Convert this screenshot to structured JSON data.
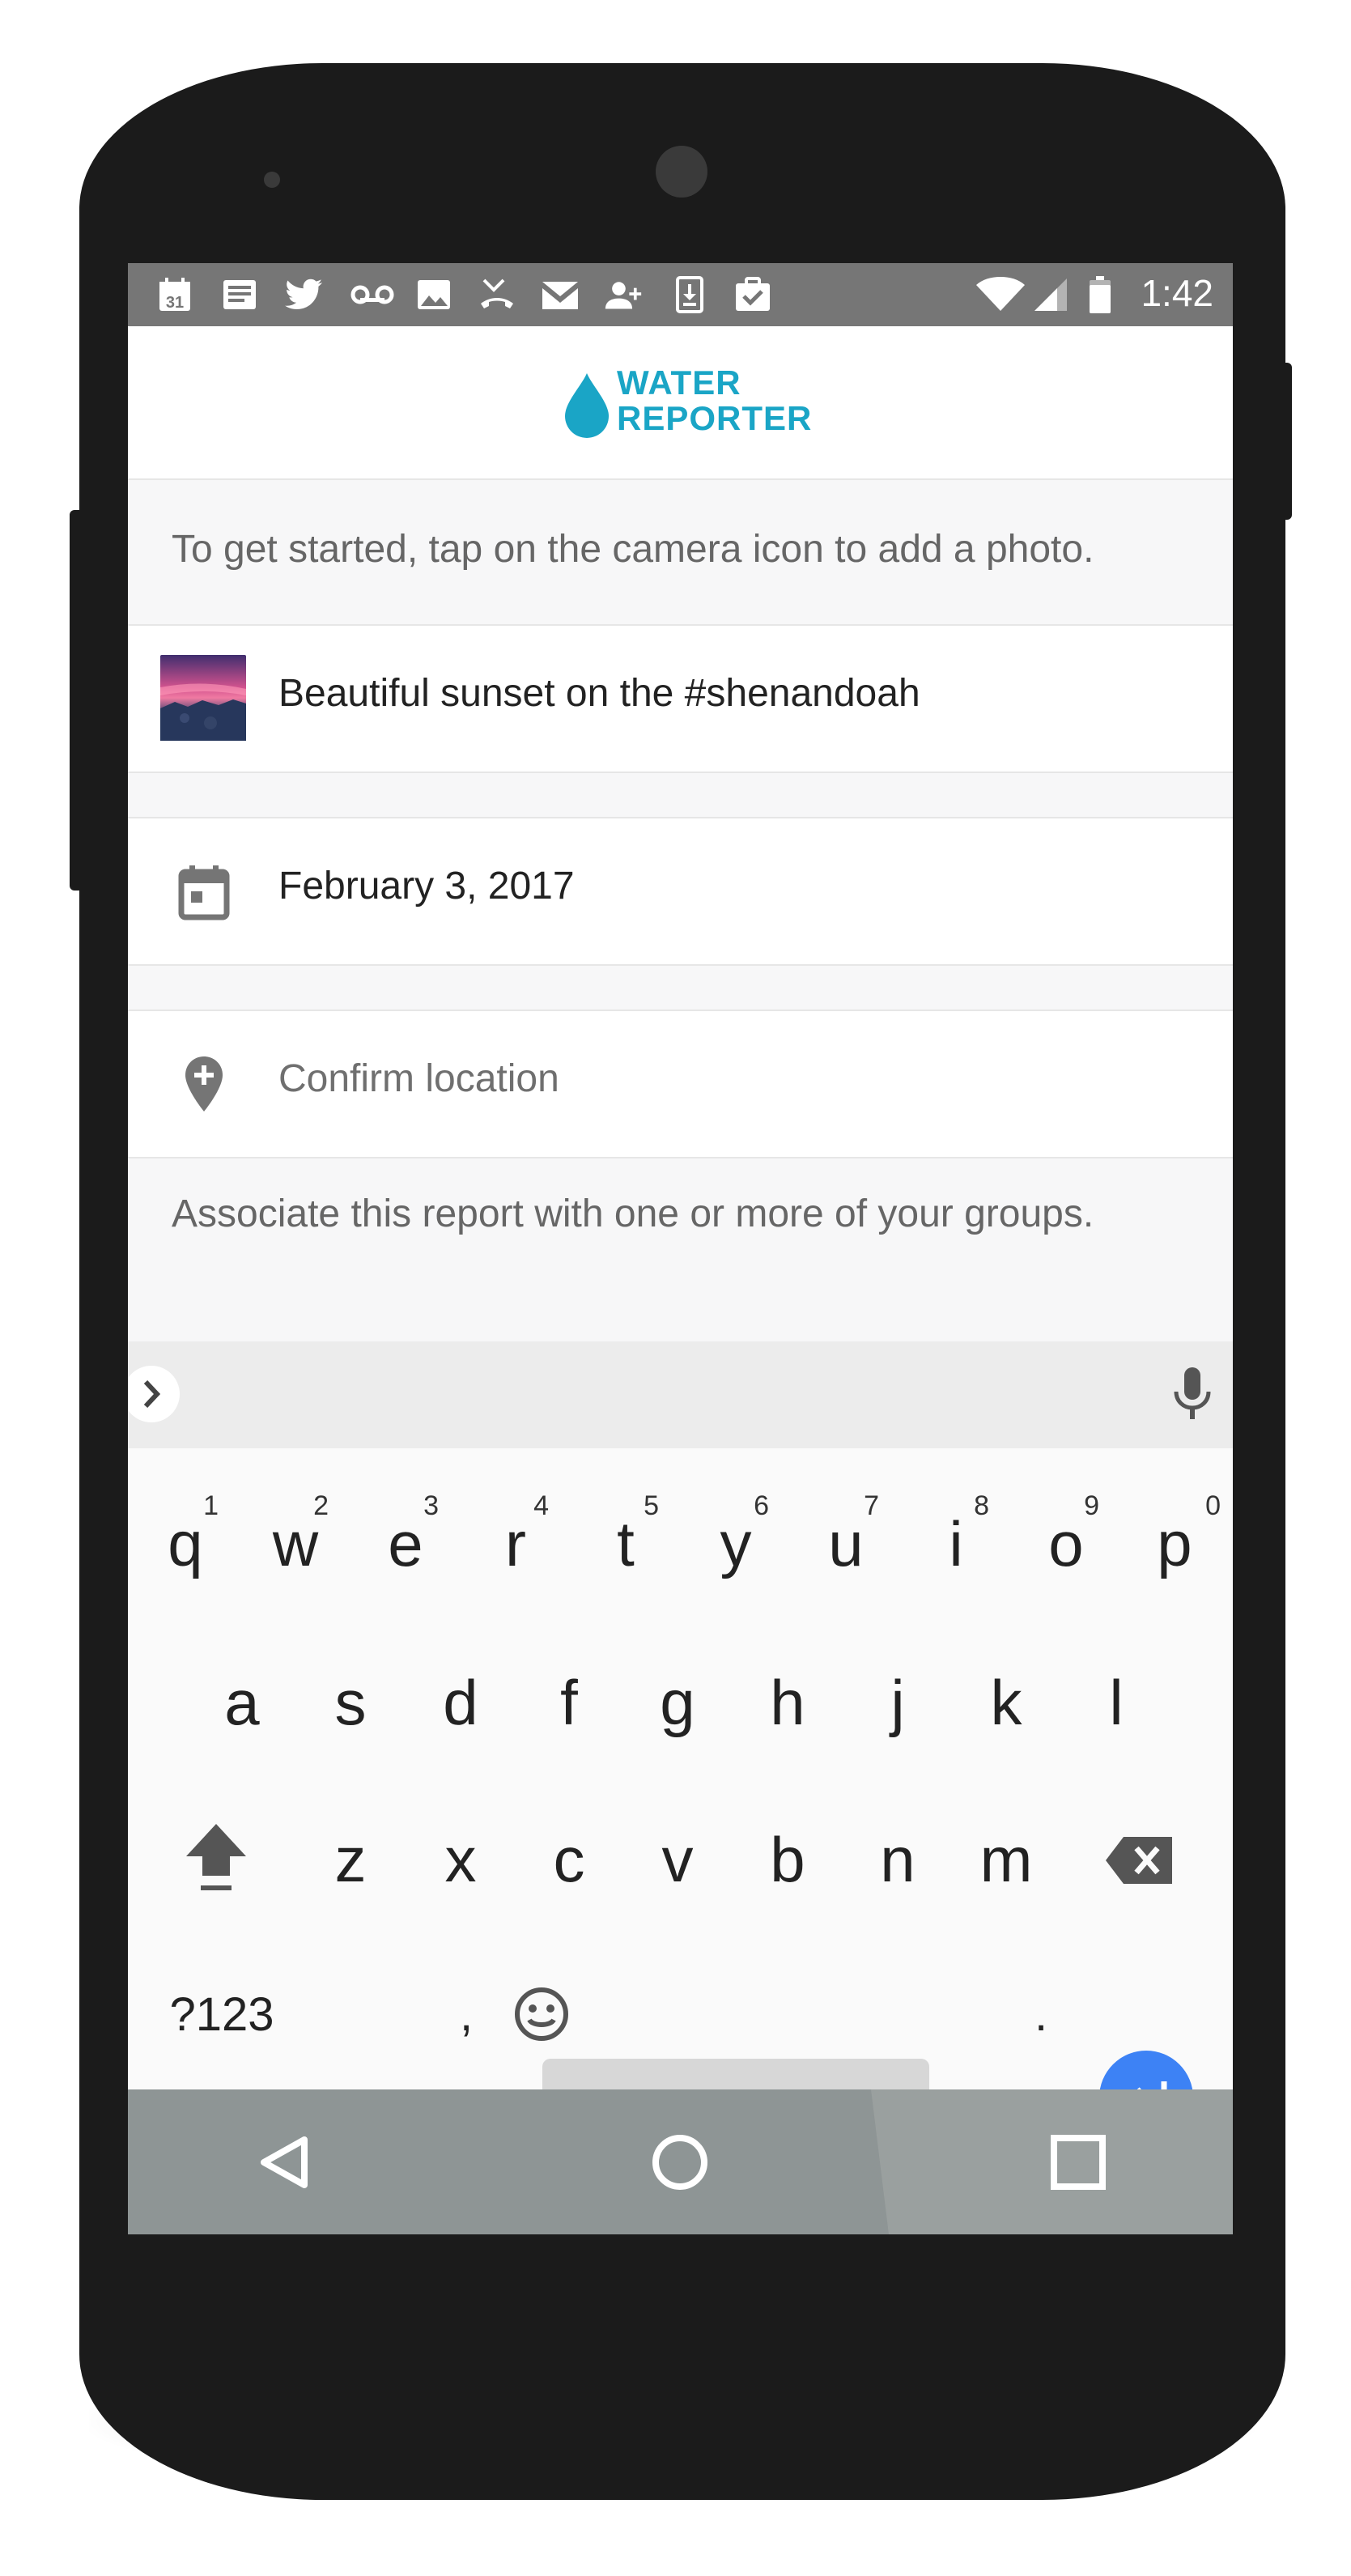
{
  "status_bar": {
    "notification_icons": [
      "calendar-31-icon",
      "news-icon",
      "twitter-icon",
      "voicemail-icon",
      "image-icon",
      "missed-call-icon",
      "gmail-icon",
      "add-contact-icon",
      "download-icon",
      "task-done-icon"
    ],
    "calendar_day": "31",
    "system_icons": [
      "wifi-icon",
      "cell-signal-icon",
      "battery-icon"
    ],
    "time": "1:42"
  },
  "app_bar": {
    "logo_icon": "water-drop-icon",
    "logo_line1": "WATER",
    "logo_line2": "REPORTER",
    "brand_color": "#1aa5c6"
  },
  "form": {
    "hint": "To get started, tap on the camera icon to add a photo.",
    "caption": "Beautiful sunset on the #shenandoah",
    "date": "February 3, 2017",
    "location_placeholder": "Confirm location",
    "groups_hint": "Associate this report with one or more of your groups."
  },
  "keyboard": {
    "row1": [
      {
        "key": "q",
        "num": "1"
      },
      {
        "key": "w",
        "num": "2"
      },
      {
        "key": "e",
        "num": "3"
      },
      {
        "key": "r",
        "num": "4"
      },
      {
        "key": "t",
        "num": "5"
      },
      {
        "key": "y",
        "num": "6"
      },
      {
        "key": "u",
        "num": "7"
      },
      {
        "key": "i",
        "num": "8"
      },
      {
        "key": "o",
        "num": "9"
      },
      {
        "key": "p",
        "num": "0"
      }
    ],
    "row2": [
      "a",
      "s",
      "d",
      "f",
      "g",
      "h",
      "j",
      "k",
      "l"
    ],
    "row3": [
      "z",
      "x",
      "c",
      "v",
      "b",
      "n",
      "m"
    ],
    "symbols_key": "?123",
    "comma_key": ",",
    "period_key": ".",
    "enter_color": "#3d82f5"
  },
  "nav_bar": {
    "icons": [
      "back-icon",
      "home-icon",
      "recents-icon"
    ]
  }
}
